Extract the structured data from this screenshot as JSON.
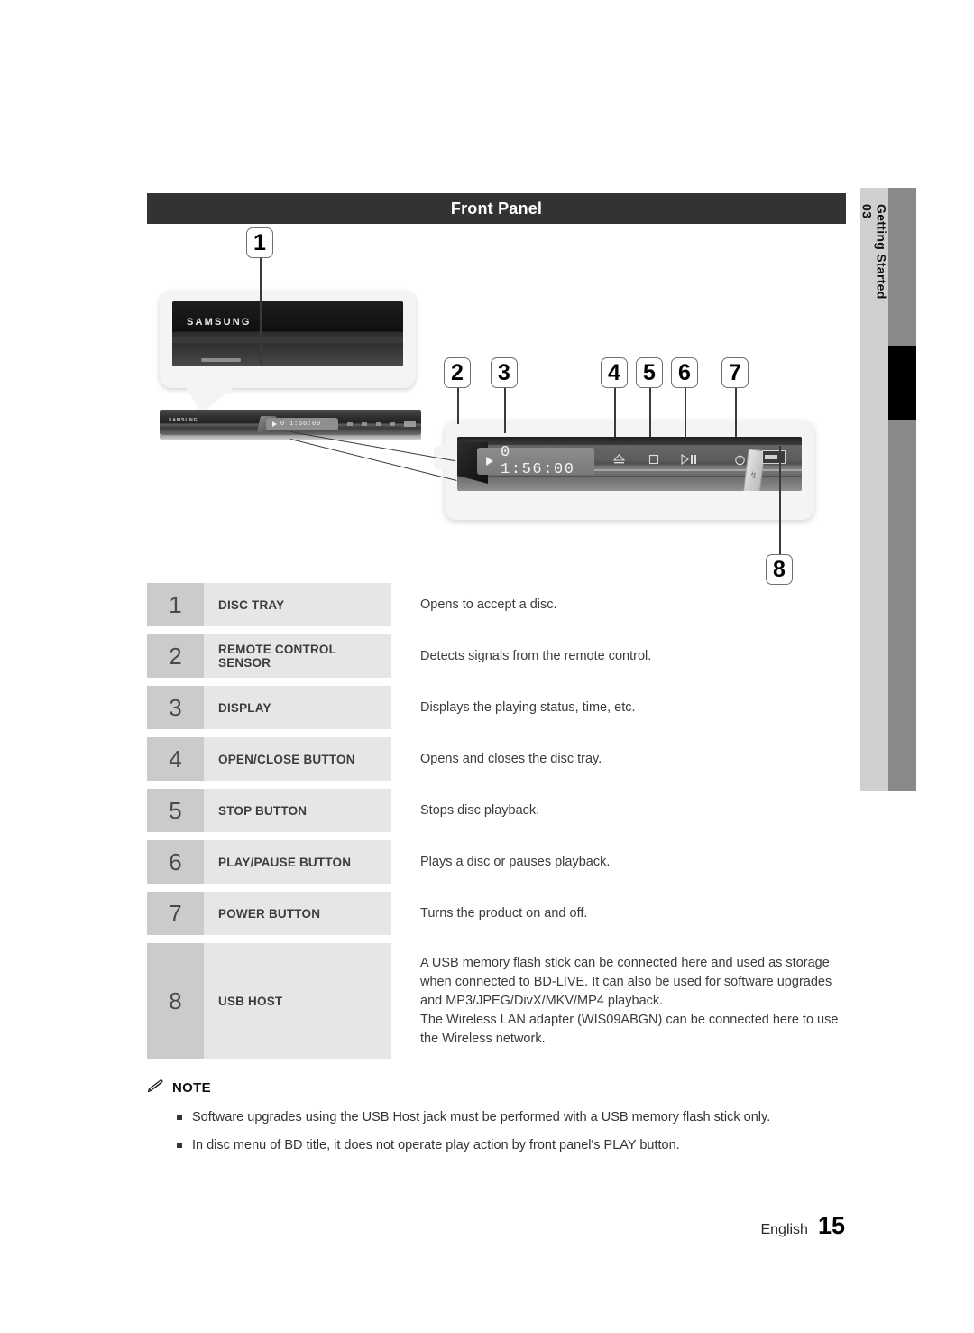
{
  "header": {
    "title": "Front Panel"
  },
  "side_tab": {
    "chapter_number": "03",
    "chapter_name": "Getting Started"
  },
  "illustration": {
    "brand_label": "SAMSUNG",
    "display_value": "0 1:56:00",
    "display_value_small": "0 1:56:00",
    "usb_icon": "usb-icon",
    "buttons": [
      {
        "name": "eject-button-icon",
        "glyph": "eject"
      },
      {
        "name": "stop-button-icon",
        "glyph": "stop"
      },
      {
        "name": "play-pause-button-icon",
        "glyph": "play-pause"
      },
      {
        "name": "power-button-icon",
        "glyph": "power"
      }
    ],
    "callouts": [
      {
        "number": "1"
      },
      {
        "number": "2"
      },
      {
        "number": "3"
      },
      {
        "number": "4"
      },
      {
        "number": "5"
      },
      {
        "number": "6"
      },
      {
        "number": "7"
      },
      {
        "number": "8"
      }
    ]
  },
  "spec_table": {
    "rows": [
      {
        "number": "1",
        "label": "DISC TRAY",
        "description": "Opens to accept a disc."
      },
      {
        "number": "2",
        "label": "REMOTE CONTROL SENSOR",
        "description": "Detects signals from the remote control."
      },
      {
        "number": "3",
        "label": "DISPLAY",
        "description": "Displays the playing status, time, etc."
      },
      {
        "number": "4",
        "label": "OPEN/CLOSE BUTTON",
        "description": "Opens and closes the disc tray."
      },
      {
        "number": "5",
        "label": "STOP BUTTON",
        "description": "Stops disc playback."
      },
      {
        "number": "6",
        "label": "PLAY/PAUSE BUTTON",
        "description": "Plays a disc or pauses playback."
      },
      {
        "number": "7",
        "label": "POWER BUTTON",
        "description": "Turns the product on and off."
      },
      {
        "number": "8",
        "label": "USB HOST",
        "description_line_1": "A USB memory flash stick can be connected here and used as storage when connected to BD-LIVE. It can also be used for software upgrades and MP3/JPEG/DivX/MKV/MP4 playback.",
        "description_line_2": "The Wireless LAN adapter (WIS09ABGN) can be connected here to use the Wireless network."
      }
    ]
  },
  "note": {
    "icon": "pencil-icon",
    "title": "NOTE",
    "items": [
      "Software upgrades using the USB Host jack must be performed with a USB memory flash stick only.",
      "In disc menu of BD title, it does not operate play action by front panel's PLAY button."
    ]
  },
  "footer": {
    "language": "English",
    "page_number": "15"
  }
}
